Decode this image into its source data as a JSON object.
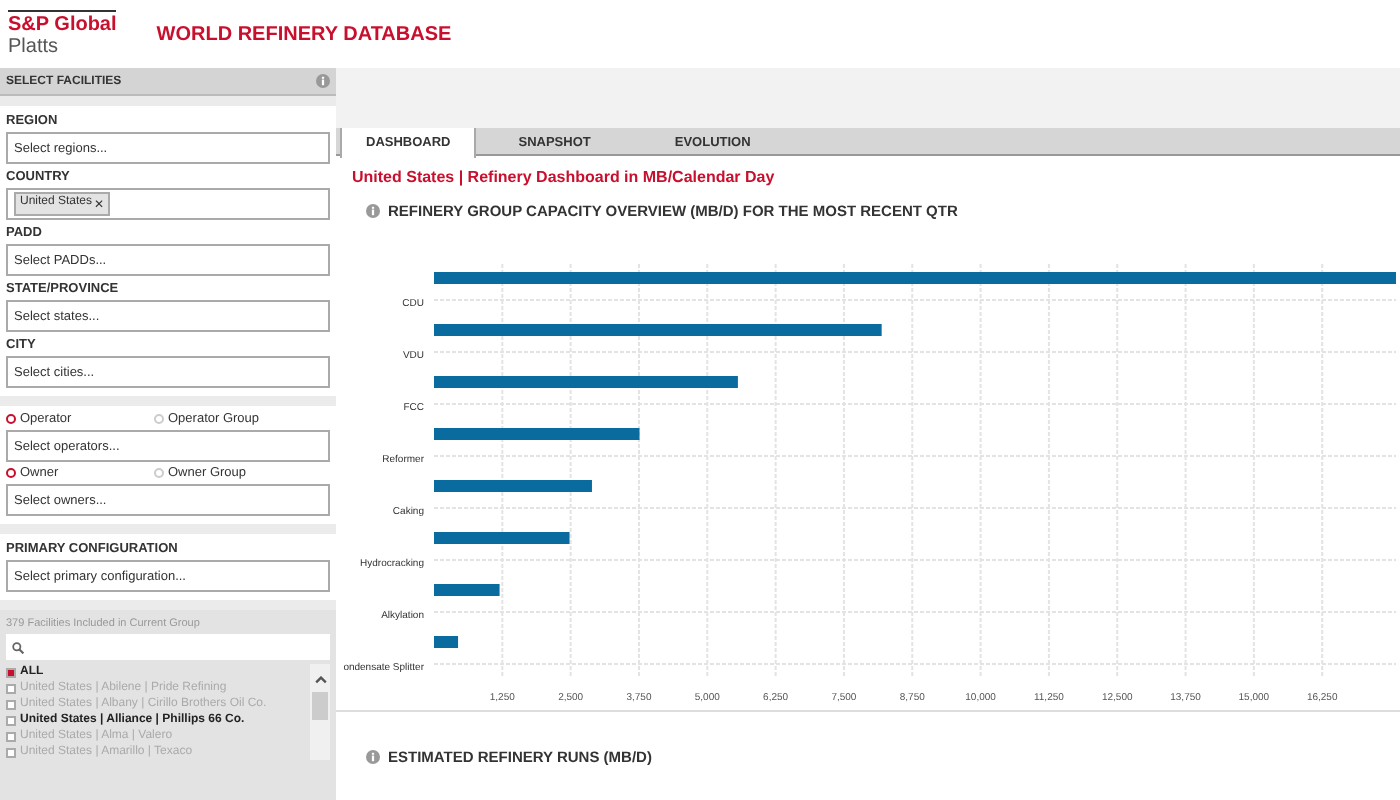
{
  "header": {
    "logo_top": "S&P Global",
    "logo_bottom": "Platts",
    "title": "WORLD REFINERY DATABASE"
  },
  "sidebar": {
    "title": "SELECT FACILITIES",
    "filters": [
      {
        "label": "REGION",
        "placeholder": "Select regions..."
      },
      {
        "label": "COUNTRY",
        "chips": [
          "United States"
        ],
        "chip_remove": "✕"
      },
      {
        "label": "PADD",
        "placeholder": "Select PADDs..."
      },
      {
        "label": "STATE/PROVINCE",
        "placeholder": "Select states..."
      },
      {
        "label": "CITY",
        "placeholder": "Select cities..."
      }
    ],
    "radio_groups": [
      {
        "options": [
          {
            "label": "Operator",
            "selected": true
          },
          {
            "label": "Operator Group",
            "selected": false
          }
        ],
        "placeholder": "Select operators..."
      },
      {
        "options": [
          {
            "label": "Owner",
            "selected": true
          },
          {
            "label": "Owner Group",
            "selected": false
          }
        ],
        "placeholder": "Select owners..."
      }
    ],
    "configuration": {
      "label": "PRIMARY CONFIGURATION",
      "placeholder": "Select primary configuration..."
    },
    "facilities": {
      "count_text": "379 Facilities Included in Current Group",
      "items": [
        {
          "label": "ALL",
          "checked": true,
          "disabled": false
        },
        {
          "label": "United States | Abilene | Pride Refining",
          "checked": false,
          "disabled": true
        },
        {
          "label": "United States | Albany | Cirillo Brothers Oil Co.",
          "checked": false,
          "disabled": true
        },
        {
          "label": "United States | Alliance | Phillips 66 Co.",
          "checked": false,
          "disabled": false
        },
        {
          "label": "United States | Alma | Valero",
          "checked": false,
          "disabled": true
        },
        {
          "label": "United States | Amarillo | Texaco",
          "checked": false,
          "disabled": true
        }
      ]
    }
  },
  "tabs": [
    {
      "label": "DASHBOARD",
      "selected": true
    },
    {
      "label": "SNAPSHOT",
      "selected": false
    },
    {
      "label": "EVOLUTION",
      "selected": false
    }
  ],
  "subtitle": "United States | Refinery Dashboard in MB/Calendar Day",
  "capacity_panel": {
    "title": "REFINERY GROUP CAPACITY OVERVIEW (MB/D) FOR THE MOST RECENT QTR",
    "chart_data": {
      "type": "bar",
      "orientation": "horizontal",
      "categories": [
        "CDU",
        "VDU",
        "FCC",
        "Reformer",
        "Caking",
        "Hydrocracking",
        "Alkylation",
        "ondensate Splitter"
      ],
      "grid": true,
      "series": [
        {
          "color": "#0a6c9e",
          "values": [
            17600,
            8190,
            5560,
            3760,
            2890,
            2480,
            1200,
            440
          ]
        }
      ],
      "xlim": [
        0,
        17600
      ],
      "xticks": [
        {
          "value": 1250,
          "label": "1,250"
        },
        {
          "value": 2500,
          "label": "2,500"
        },
        {
          "value": 3750,
          "label": "3,750"
        },
        {
          "value": 5000,
          "label": "5,000"
        },
        {
          "value": 6250,
          "label": "6,250"
        },
        {
          "value": 7500,
          "label": "7,500"
        },
        {
          "value": 8750,
          "label": "8,750"
        },
        {
          "value": 10000,
          "label": "10,000"
        },
        {
          "value": 11250,
          "label": "11,250"
        },
        {
          "value": 12500,
          "label": "12,500"
        },
        {
          "value": 13750,
          "label": "13,750"
        },
        {
          "value": 15000,
          "label": "15,000"
        },
        {
          "value": 16250,
          "label": "16,250"
        }
      ]
    }
  },
  "runs_panel": {
    "title": "ESTIMATED REFINERY RUNS (MB/D)"
  }
}
